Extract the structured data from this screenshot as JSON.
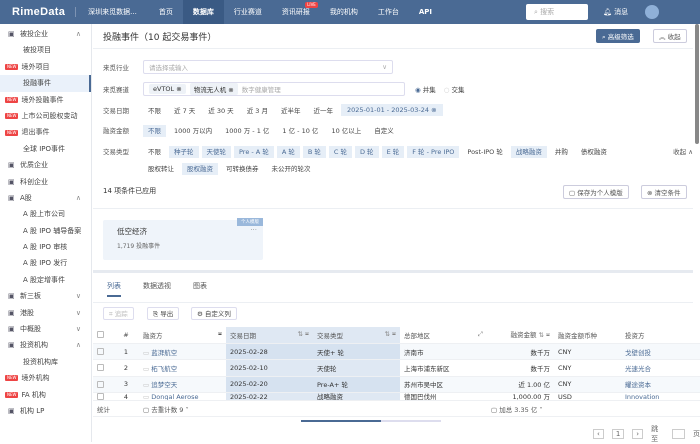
{
  "topbar": {
    "logo": "RimeData",
    "org": "深圳来觅数据...",
    "nav": [
      "首页",
      "数据库",
      "行业赛道",
      "资讯研报",
      "我的机构",
      "工作台",
      "API"
    ],
    "live_badge": "LIVE",
    "search_placeholder": "搜索",
    "messages": "消息"
  },
  "sidebar": {
    "items": [
      {
        "label": "被投企业",
        "badge": "",
        "sub": false,
        "icon": "building-icon",
        "chev": "∧"
      },
      {
        "label": "被投项目",
        "badge": "",
        "sub": true
      },
      {
        "label": "境外项目",
        "badge": "NEW",
        "sub": true
      },
      {
        "label": "投融事件",
        "badge": "",
        "sub": true,
        "selected": true
      },
      {
        "label": "境外投融事件",
        "badge": "NEW",
        "sub": true
      },
      {
        "label": "上市公司股权变动",
        "badge": "NEW",
        "sub": true
      },
      {
        "label": "退出事件",
        "badge": "NEW",
        "sub": true
      },
      {
        "label": "全球 IPO事件",
        "badge": "",
        "sub": true
      },
      {
        "label": "优质企业",
        "badge": "",
        "sub": false,
        "icon": "medal-icon"
      },
      {
        "label": "科创企业",
        "badge": "",
        "sub": false,
        "icon": "science-icon"
      },
      {
        "label": "A股",
        "badge": "",
        "sub": false,
        "icon": "monitor-icon",
        "chev": "∧"
      },
      {
        "label": "A 股上市公司",
        "badge": "",
        "sub": true
      },
      {
        "label": "A 股 IPO 辅导备案",
        "badge": "",
        "sub": true
      },
      {
        "label": "A 股 IPO 审核",
        "badge": "",
        "sub": true
      },
      {
        "label": "A 股 IPO 发行",
        "badge": "",
        "sub": true
      },
      {
        "label": "A 股定增事件",
        "badge": "",
        "sub": true
      },
      {
        "label": "新三板",
        "badge": "",
        "sub": false,
        "icon": "target-icon",
        "chev": "∨"
      },
      {
        "label": "港股",
        "badge": "",
        "sub": false,
        "icon": "chart-icon",
        "chev": "∨"
      },
      {
        "label": "中概股",
        "badge": "",
        "sub": false,
        "icon": "chart-icon",
        "chev": "∨"
      },
      {
        "label": "投资机构",
        "badge": "",
        "sub": false,
        "icon": "bank-icon",
        "chev": "∧"
      },
      {
        "label": "投资机构库",
        "badge": "",
        "sub": true
      },
      {
        "label": "境外机构",
        "badge": "NEW",
        "sub": true
      },
      {
        "label": "FA 机构",
        "badge": "NEW",
        "sub": true
      },
      {
        "label": "机构 LP",
        "badge": "",
        "sub": false,
        "icon": "people-icon"
      }
    ]
  },
  "header": {
    "title": "投融事件（10 起交易事件）",
    "advanced_filter": "高级筛选",
    "collapse": "收起"
  },
  "filters": {
    "industry": {
      "label": "来觅行业",
      "placeholder": "请选择或输入"
    },
    "track": {
      "label": "来觅赛道",
      "tags": [
        "eVTOL",
        "物流无人机"
      ],
      "placeholder": "数字健康管理",
      "union": "并集",
      "intersection": "交集"
    },
    "date": {
      "label": "交易日期",
      "options": [
        "不限",
        "近 7 天",
        "近 30 天",
        "近 3 月",
        "近半年",
        "近一年"
      ],
      "range": "2025-01-01 - 2025-03-24"
    },
    "amount": {
      "label": "融资金额",
      "options": [
        "不限",
        "1000 万以内",
        "1000 万 - 1 亿",
        "1 亿 - 10 亿",
        "10 亿以上",
        "自定义"
      ]
    },
    "type": {
      "label": "交易类型",
      "options": [
        "不限",
        "种子轮",
        "天使轮",
        "Pre - A 轮",
        "A 轮",
        "B 轮",
        "C 轮",
        "D 轮",
        "E 轮",
        "F 轮 - Pre IPO",
        "Post-IPO 轮",
        "战略融资",
        "并购",
        "债权融资"
      ],
      "options2": [
        "股权转让",
        "股权融资",
        "可转换债券",
        "未公开的轮次"
      ],
      "collapse": "收起"
    },
    "applied": "14 项条件已应用",
    "save_template": "保存为个人模版",
    "clear": "清空条件"
  },
  "template_card": {
    "badge": "个人模版",
    "name": "低空经济",
    "count": "1,719 投融事件"
  },
  "tabs": [
    "列表",
    "数据透视",
    "图表"
  ],
  "toolbar": {
    "track": "追踪",
    "export": "导出",
    "custom_columns": "自定义列"
  },
  "table": {
    "columns": [
      "#",
      "融资方",
      "交易日期",
      "交易类型",
      "总部地区",
      "融资金额",
      "融资金额币种",
      "投资方"
    ],
    "rows": [
      {
        "n": "1",
        "company": "蓝湃航空",
        "date": "2025-02-28",
        "type": "天使+ 轮",
        "region": "济南市",
        "amount": "数千万",
        "currency": "CNY",
        "investor": "戈壁创投"
      },
      {
        "n": "2",
        "company": "柘飞航空",
        "date": "2025-02-10",
        "type": "天使轮",
        "region": "上海市浦东新区",
        "amount": "数千万",
        "currency": "CNY",
        "investor": "光速光合"
      },
      {
        "n": "3",
        "company": "追梦空天",
        "date": "2025-02-20",
        "type": "Pre-A+ 轮",
        "region": "苏州市吴中区",
        "amount": "近 1.00 亿",
        "currency": "CNY",
        "investor": "耀途资本"
      },
      {
        "n": "4",
        "company": "Dongal Aerose",
        "date": "2025-02-22",
        "type": "战略融资",
        "region": "德国巴伐州",
        "amount": "1,000.00 万",
        "currency": "USD",
        "investor": "Innovation"
      }
    ],
    "footer": {
      "stat": "统计",
      "distinct": "去重计数",
      "distinct_val": "9",
      "sum": "加总",
      "sum_val": "3.35 亿"
    }
  },
  "pager": {
    "page": "1",
    "goto": "跳至",
    "page_unit": "页"
  }
}
